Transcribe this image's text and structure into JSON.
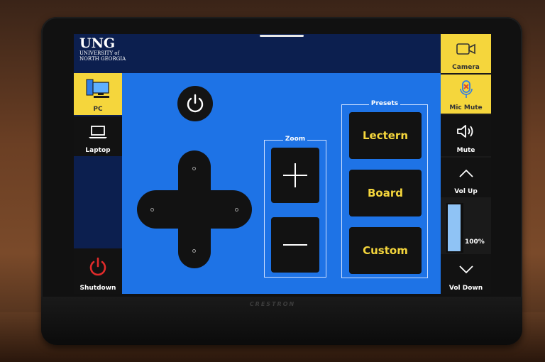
{
  "header": {
    "logo_main": "UNG",
    "logo_sub1": "UNIVERSITY of",
    "logo_sub2": "NORTH GEORGIA"
  },
  "sources": [
    {
      "label": "PC",
      "icon": "pc-icon",
      "active": true
    },
    {
      "label": "Laptop",
      "icon": "laptop-icon",
      "active": false
    }
  ],
  "shutdown_label": "Shutdown",
  "zoom": {
    "title": "Zoom"
  },
  "presets": {
    "title": "Presets",
    "items": [
      "Lectern",
      "Board",
      "Custom"
    ]
  },
  "right_rail": {
    "camera_label": "Camera",
    "mic_mute_label": "Mic Mute",
    "mute_label": "Mute",
    "vol_up_label": "Vol Up",
    "vol_down_label": "Vol Down",
    "volume_text": "100%",
    "volume_level": 1.0
  },
  "brand": "CRESTRON",
  "colors": {
    "accent_yellow": "#f5d63c",
    "screen_blue": "#1e73e6",
    "header_navy": "#0c1f4f",
    "mic_red": "#e04b2b",
    "shutdown_red": "#e02b2b"
  }
}
